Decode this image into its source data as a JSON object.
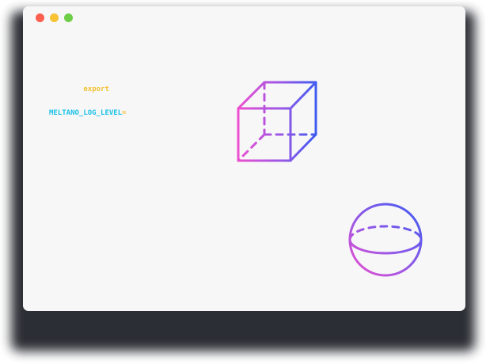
{
  "window": {
    "traffic_lights": [
      {
        "name": "close",
        "color": "#ff5f4e"
      },
      {
        "name": "minimize",
        "color": "#f7c233"
      },
      {
        "name": "maximize",
        "color": "#6fce47"
      }
    ]
  },
  "code": {
    "line1_keyword": "export",
    "line2_variable": "MELTANO_LOG_LEVEL",
    "line2_operator": "="
  },
  "colors": {
    "keyword": "#f2c230",
    "variable": "#19c2e6",
    "gradient_pink": "#ee4fcf",
    "gradient_blue": "#3d5cf0",
    "window_background": "#f7f7f8",
    "shadow": "#1b1d24"
  },
  "illustrations": {
    "shape_1": "wireframe-cube",
    "shape_2": "wireframe-sphere"
  }
}
